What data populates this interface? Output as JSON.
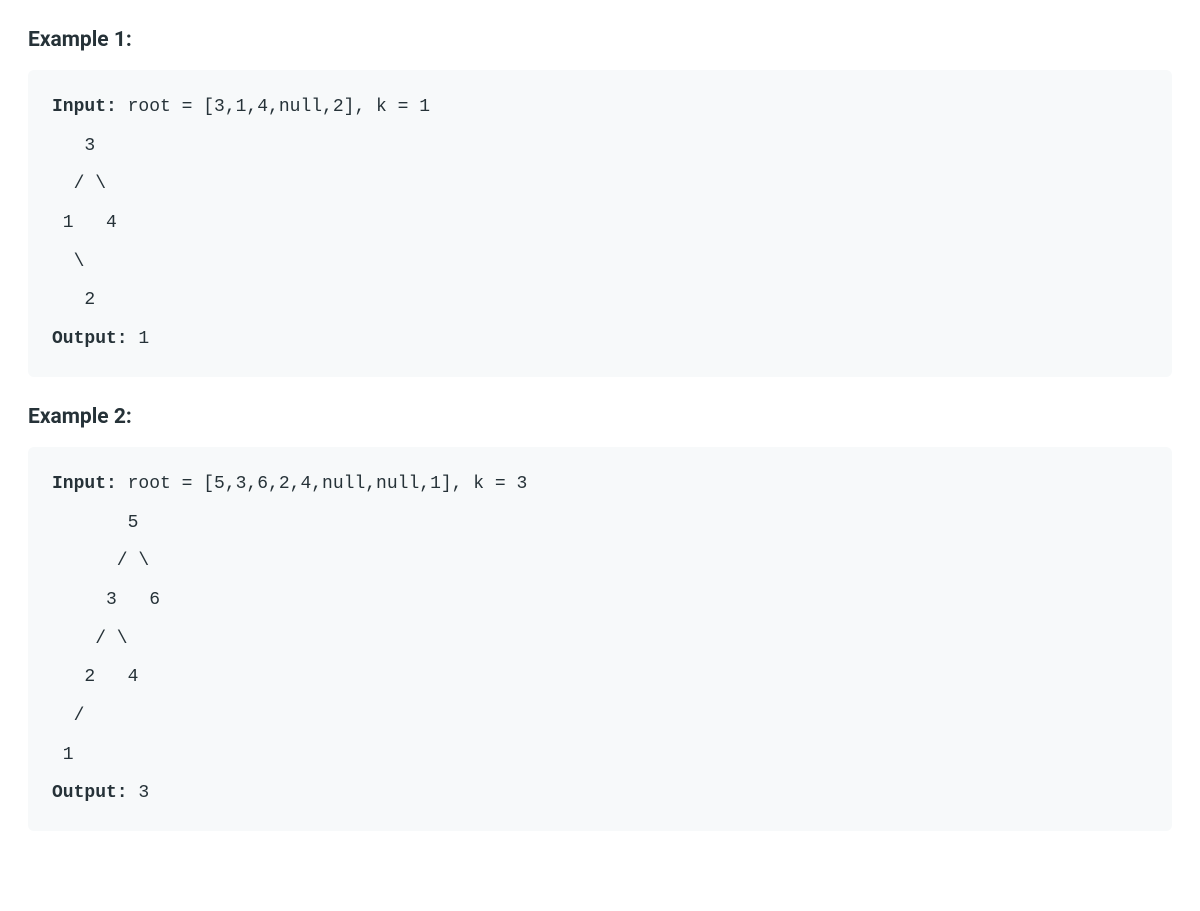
{
  "examples": [
    {
      "heading": "Example 1:",
      "input_label": "Input:",
      "input_rest": " root = [3,1,4,null,2], k = 1",
      "tree": "   3\n  / \\\n 1   4\n  \\\n   2",
      "output_label": "Output:",
      "output_rest": " 1"
    },
    {
      "heading": "Example 2:",
      "input_label": "Input:",
      "input_rest": " root = [5,3,6,2,4,null,null,1], k = 3",
      "tree": "       5\n      / \\\n     3   6\n    / \\\n   2   4\n  /\n 1",
      "output_label": "Output:",
      "output_rest": " 3"
    }
  ]
}
